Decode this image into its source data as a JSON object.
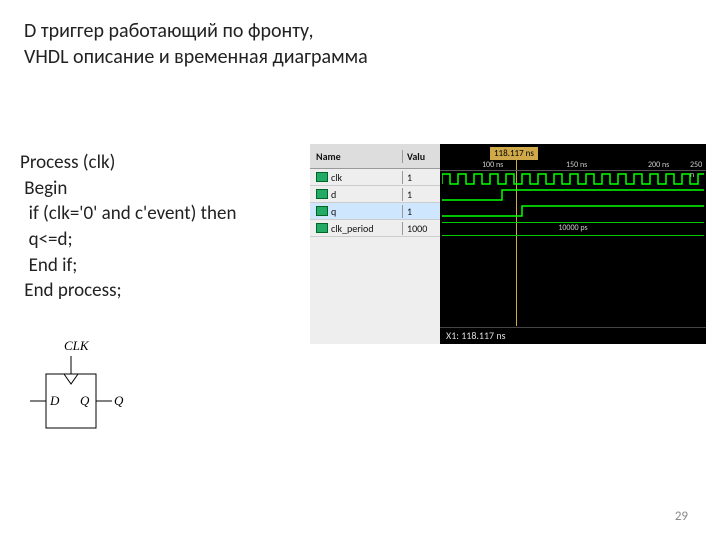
{
  "title_line1": "D триггер работающий по фронту,",
  "title_line2": "VHDL описание и временная диаграмма",
  "code": "Process (clk)\n Begin\n  if (clk='0' and c'event) then\n  q<=d;\n  End if;\n End process;",
  "dff": {
    "clk": "CLK",
    "d": "D",
    "qint": "Q",
    "qout": "Q"
  },
  "sim": {
    "col_name": "Name",
    "col_value": "Valu",
    "marker": "118.117 ns",
    "status": "X1: 118.117 ns",
    "ticks": [
      "100 ns",
      "150 ns",
      "200 ns",
      "250 n"
    ],
    "bus_value": "10000 ps",
    "signals": [
      {
        "name": "clk",
        "value": "1",
        "sel": false
      },
      {
        "name": "d",
        "value": "1",
        "sel": false
      },
      {
        "name": "q",
        "value": "1",
        "sel": true
      },
      {
        "name": "clk_period",
        "value": "1000",
        "sel": false
      }
    ]
  },
  "page": "29"
}
